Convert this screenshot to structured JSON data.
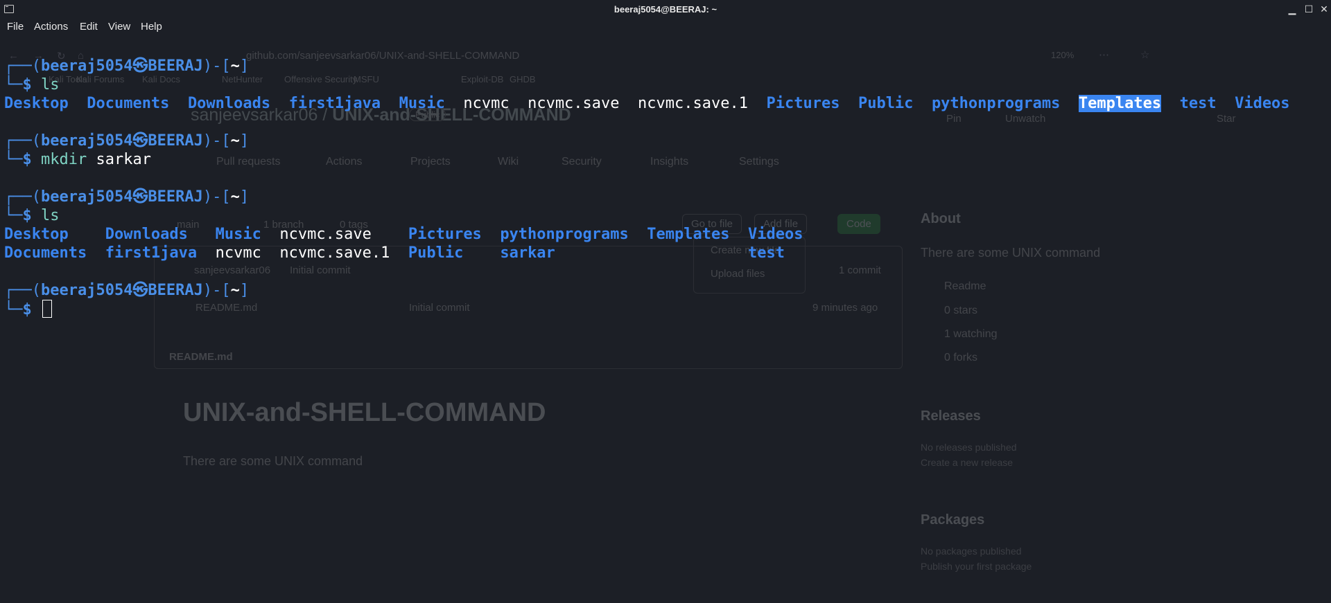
{
  "window": {
    "title": "beeraj5054@BEERAJ: ~"
  },
  "menu": [
    "File",
    "Actions",
    "Edit",
    "View",
    "Help"
  ],
  "prompt": {
    "user_host": "beeraj5054㉿BEERAJ",
    "dir": "~",
    "symbol": "$"
  },
  "blocks": [
    {
      "command": "ls",
      "arg": "",
      "output_rows": [
        [
          {
            "name": "Desktop",
            "type": "dir"
          },
          {
            "name": "Documents",
            "type": "dir"
          },
          {
            "name": "Downloads",
            "type": "dir"
          },
          {
            "name": "first1java",
            "type": "dir"
          },
          {
            "name": "Music",
            "type": "dir"
          },
          {
            "name": "ncvmc",
            "type": "file"
          },
          {
            "name": "ncvmc.save",
            "type": "file"
          },
          {
            "name": "ncvmc.save.1",
            "type": "file"
          },
          {
            "name": "Pictures",
            "type": "dir"
          },
          {
            "name": "Public",
            "type": "dir"
          },
          {
            "name": "pythonprograms",
            "type": "dir"
          },
          {
            "name": "Templates",
            "type": "dir",
            "highlight": true
          },
          {
            "name": "test",
            "type": "dir"
          },
          {
            "name": "Videos",
            "type": "dir"
          }
        ]
      ]
    },
    {
      "command": "mkdir",
      "arg": "sarkar",
      "output_rows": []
    },
    {
      "command": "ls",
      "arg": "",
      "output_rows": [
        [
          {
            "name": "Desktop",
            "type": "dir"
          },
          {
            "name": "Downloads",
            "type": "dir"
          },
          {
            "name": "Music",
            "type": "dir"
          },
          {
            "name": "ncvmc.save",
            "type": "file"
          },
          {
            "name": "Pictures",
            "type": "dir"
          },
          {
            "name": "pythonprograms",
            "type": "dir"
          },
          {
            "name": "Templates",
            "type": "dir"
          },
          {
            "name": "Videos",
            "type": "dir"
          }
        ],
        [
          {
            "name": "Documents",
            "type": "dir"
          },
          {
            "name": "first1java",
            "type": "dir"
          },
          {
            "name": "ncvmc",
            "type": "file"
          },
          {
            "name": "ncvmc.save.1",
            "type": "file"
          },
          {
            "name": "Public",
            "type": "dir"
          },
          {
            "name": "sarkar",
            "type": "dir"
          },
          {
            "name": "",
            "type": "file"
          },
          {
            "name": "test",
            "type": "dir"
          }
        ]
      ]
    },
    {
      "command": "",
      "arg": "",
      "output_rows": [],
      "cursor": true
    }
  ],
  "ghost_browser": {
    "url": "github.com/sanjeevsarkar06/UNIX-and-SHELL-COMMAND",
    "zoom": "120%",
    "bookmarks": [
      "Kali Tools",
      "Kali Forums",
      "Kali Docs",
      "NetHunter",
      "Offensive Security",
      "MSFU",
      "Exploit-DB",
      "GHDB"
    ],
    "repo_owner": "sanjeevsarkar06",
    "repo_name": "UNIX-and-SHELL-COMMAND",
    "visibility": "Public",
    "tabs": [
      "Pull requests",
      "Actions",
      "Projects",
      "Wiki",
      "Security",
      "Insights",
      "Settings"
    ],
    "branch": "main",
    "branches": "1 branch",
    "tags": "0 tags",
    "go_to_file": "Go to file",
    "add_file": "Add file",
    "code": "Code",
    "dropdown": [
      "Create new file",
      "Upload files"
    ],
    "commit_author": "sanjeevsarkar06",
    "commit_msg": "Initial commit",
    "commits": "1 commit",
    "file_name": "README.md",
    "file_commit": "Initial commit",
    "file_time": "9 minutes ago",
    "readme_header": "README.md",
    "readme_title": "UNIX-and-SHELL-COMMAND",
    "readme_text": "There are some UNIX command",
    "about": {
      "title": "About",
      "desc": "There are some UNIX command",
      "items": [
        "Readme",
        "0 stars",
        "1 watching",
        "0 forks"
      ]
    },
    "releases": {
      "title": "Releases",
      "lines": [
        "No releases published",
        "Create a new release"
      ]
    },
    "packages": {
      "title": "Packages",
      "lines": [
        "No packages published",
        "Publish your first package"
      ]
    },
    "top_right": [
      "Pin",
      "Unwatch",
      "Star"
    ]
  },
  "colors": {
    "background": "#1c1f26",
    "prompt": "#4a8fe8",
    "directory": "#3a85f0",
    "command": "#7fd4c4"
  }
}
